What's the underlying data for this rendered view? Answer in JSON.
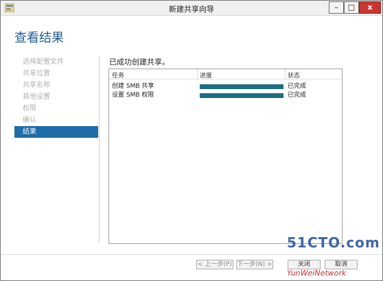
{
  "window": {
    "title": "新建共享向导",
    "controls": {
      "minimize": "–",
      "maximize": "□",
      "close": "x"
    }
  },
  "page": {
    "header": "查看结果"
  },
  "sidebar": {
    "items": [
      {
        "label": "选择配置文件",
        "active": false
      },
      {
        "label": "共享位置",
        "active": false
      },
      {
        "label": "共享名称",
        "active": false
      },
      {
        "label": "其他设置",
        "active": false
      },
      {
        "label": "权限",
        "active": false
      },
      {
        "label": "确认",
        "active": false
      },
      {
        "label": "结果",
        "active": true
      }
    ]
  },
  "main": {
    "status_message": "已成功创建共享。",
    "table": {
      "headers": {
        "task": "任务",
        "progress": "进度",
        "status": "状态"
      },
      "rows": [
        {
          "task": "创建 SMB 共享",
          "progress": 1.0,
          "status": "已完成"
        },
        {
          "task": "设置 SMB 权限",
          "progress": 1.0,
          "status": "已完成"
        }
      ]
    }
  },
  "footer": {
    "prev": "< 上一步(P)",
    "next": "下一步(N) >",
    "close": "关闭",
    "cancel": "取消"
  },
  "watermark": {
    "top": "51CTO.com",
    "bottom": "YunWeiNetwork"
  },
  "colors": {
    "header": "#1f5d92",
    "active_nav": "#1e6ca8",
    "progress_bar": "#1c6e84",
    "close_button": "#c7372f"
  }
}
